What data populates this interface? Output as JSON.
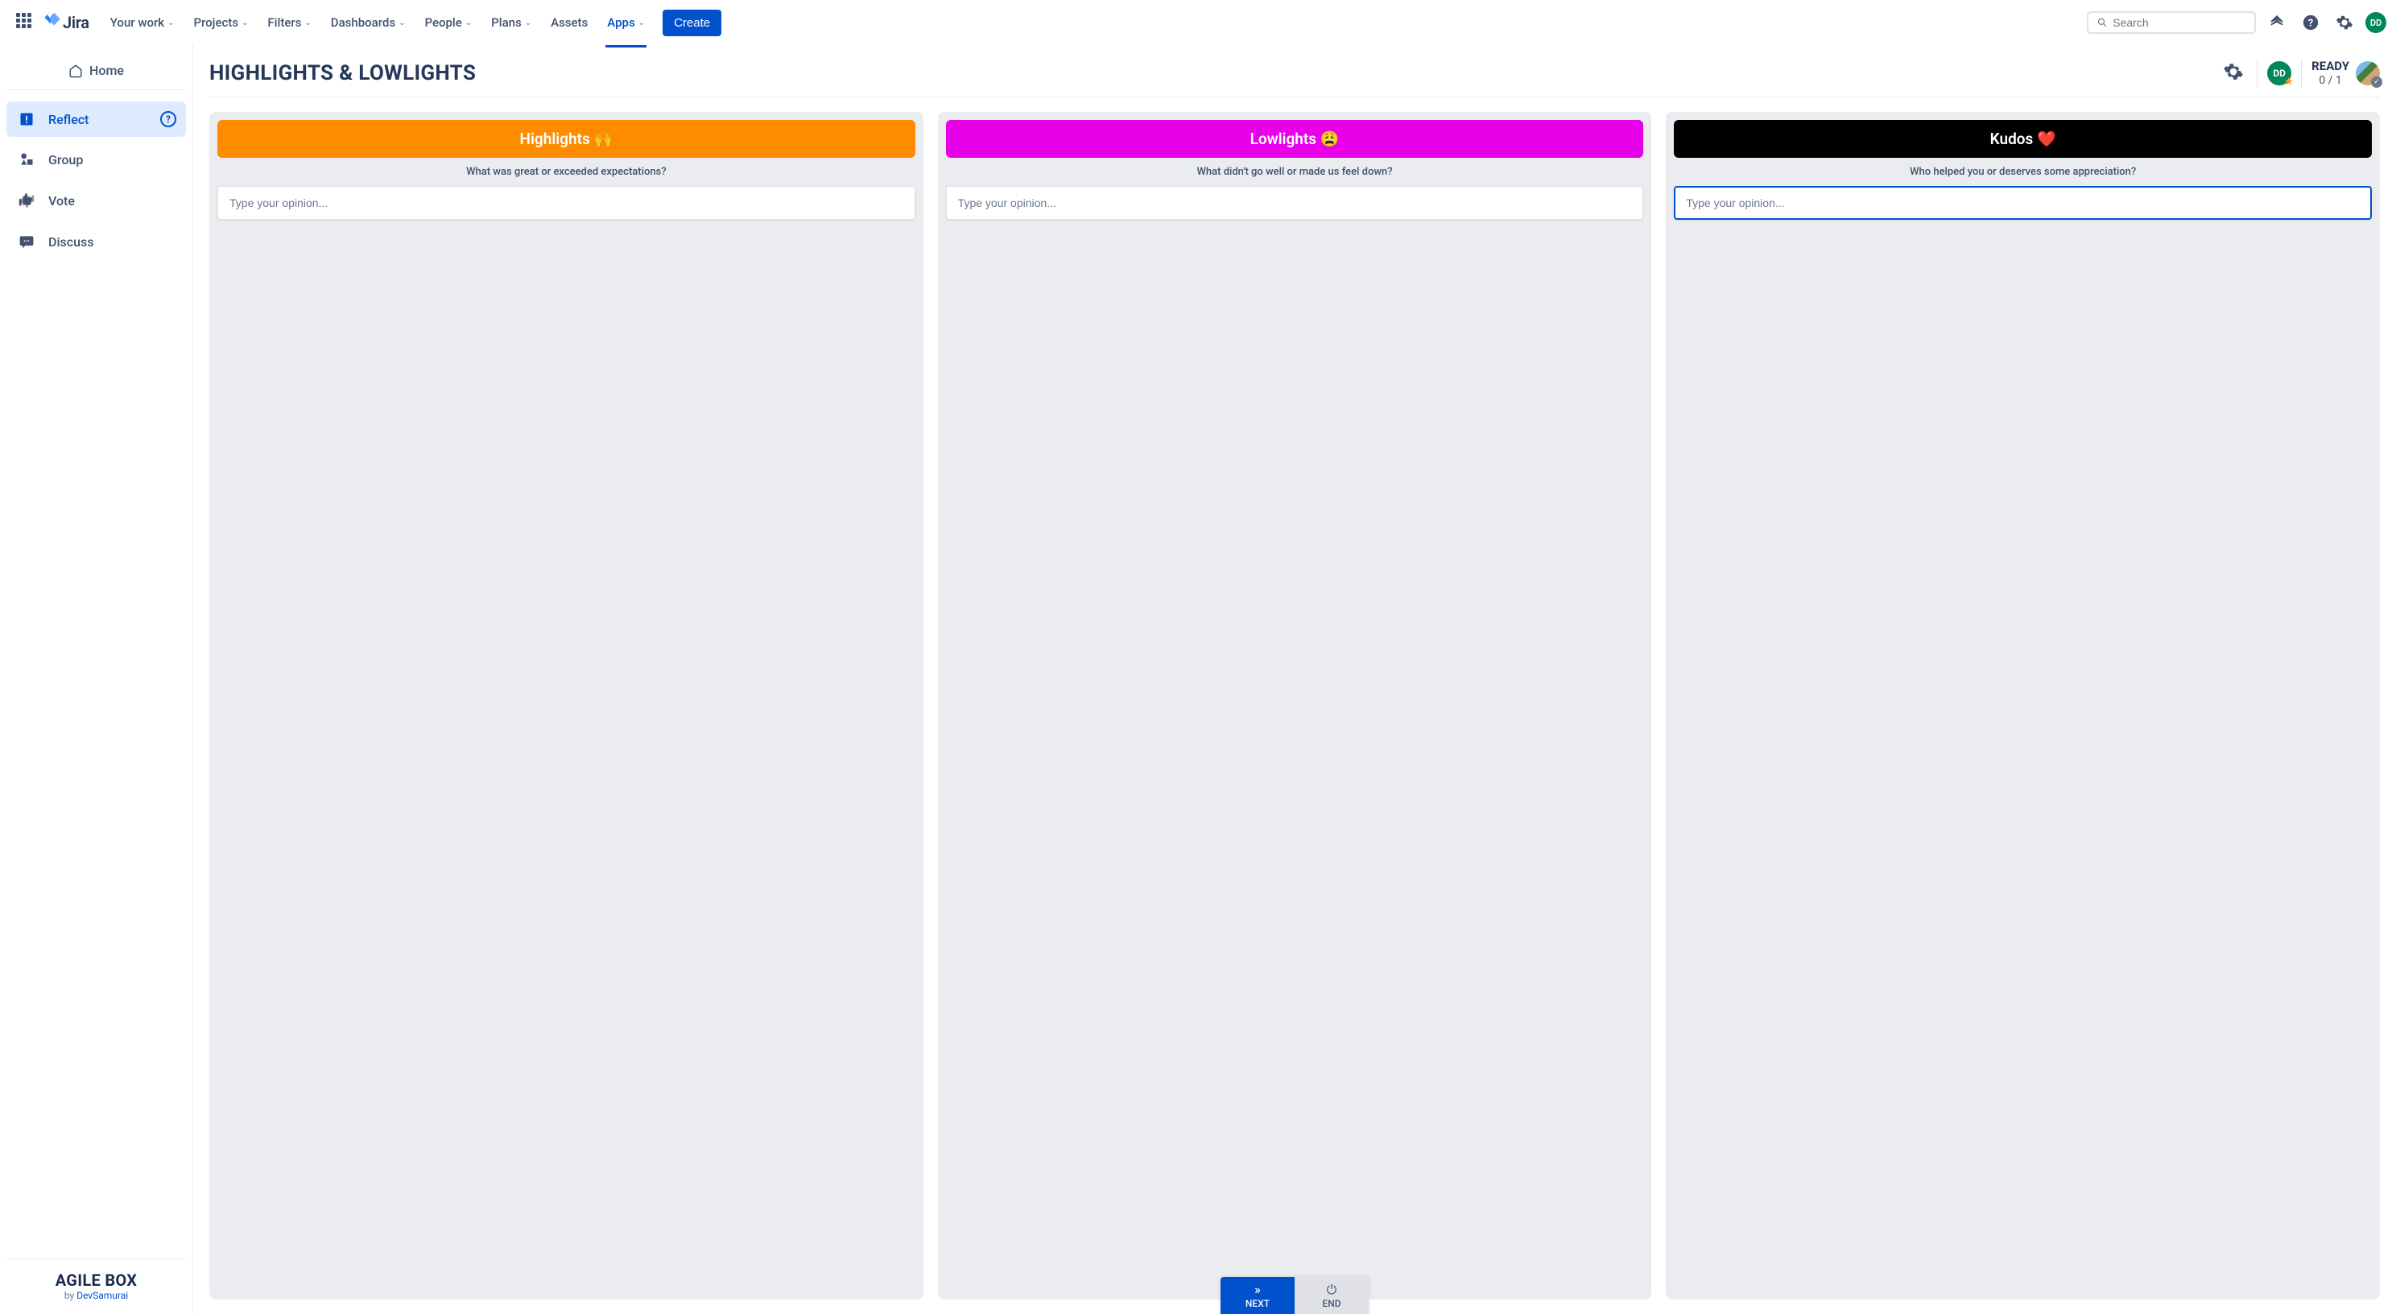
{
  "nav": {
    "product": "Jira",
    "items": [
      "Your work",
      "Projects",
      "Filters",
      "Dashboards",
      "People",
      "Plans",
      "Assets",
      "Apps"
    ],
    "active_index": 7,
    "no_chevron": [
      6
    ],
    "create": "Create",
    "search_placeholder": "Search",
    "avatar_initials": "DD"
  },
  "sidebar": {
    "home": "Home",
    "items": [
      {
        "label": "Reflect",
        "icon": "warning"
      },
      {
        "label": "Group",
        "icon": "shapes"
      },
      {
        "label": "Vote",
        "icon": "thumbs"
      },
      {
        "label": "Discuss",
        "icon": "chat"
      }
    ],
    "active_index": 0,
    "footer_title": "AGILE BOX",
    "footer_by": "by ",
    "footer_link": "DevSamurai"
  },
  "page": {
    "title": "HIGHLIGHTS & LOWLIGHTS",
    "ready_label": "READY",
    "ready_count": "0 / 1",
    "presence_initials": "DD"
  },
  "columns": [
    {
      "title": "Highlights 🙌",
      "subtitle": "What was great or exceeded expectations?",
      "placeholder": "Type your opinion...",
      "color": "c1"
    },
    {
      "title": "Lowlights 😩",
      "subtitle": "What didn't go well or made us feel down?",
      "placeholder": "Type your opinion...",
      "color": "c2"
    },
    {
      "title": "Kudos ❤️",
      "subtitle": "Who helped you or deserves some appreciation?",
      "placeholder": "Type your opinion...",
      "color": "c3",
      "focused": true
    }
  ],
  "actions": {
    "next": "NEXT",
    "end": "END"
  }
}
